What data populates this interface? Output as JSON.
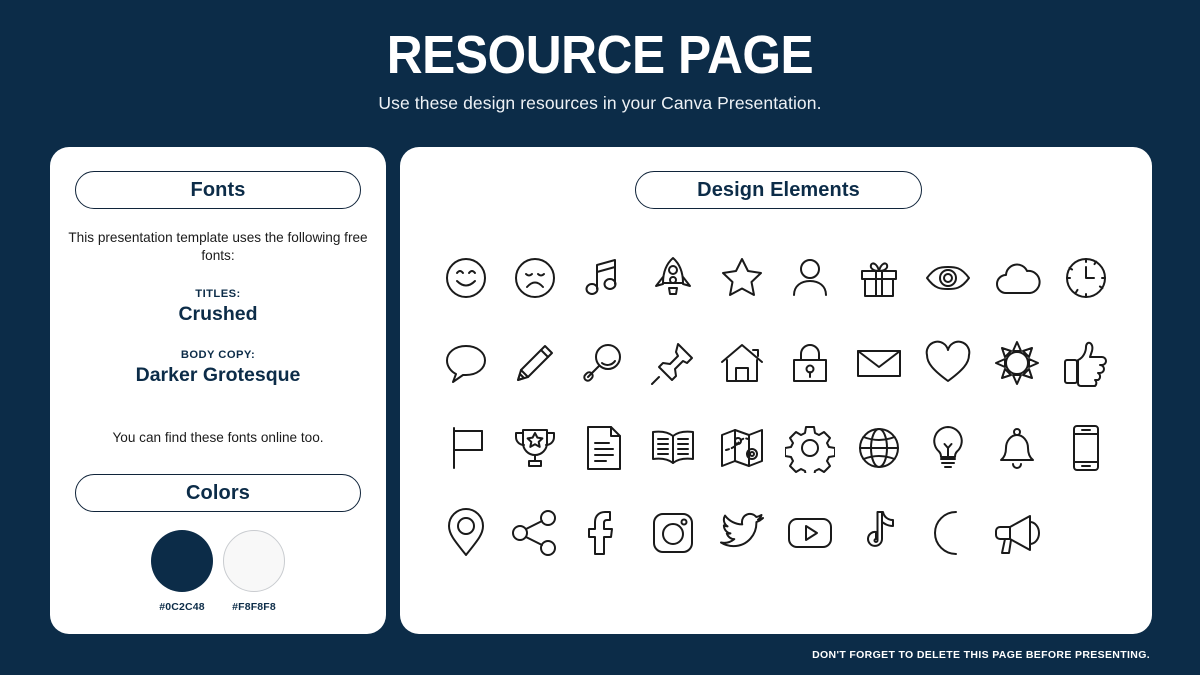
{
  "header": {
    "title": "RESOURCE PAGE",
    "subtitle": "Use these design resources in your Canva Presentation."
  },
  "fonts_card": {
    "heading": "Fonts",
    "intro": "This presentation template uses the following free fonts:",
    "titles_kicker": "TITLES:",
    "titles_font": "Crushed",
    "body_kicker": "BODY COPY:",
    "body_font": "Darker Grotesque",
    "note": "You can find these fonts online too."
  },
  "colors_card": {
    "heading": "Colors",
    "swatches": [
      {
        "hex": "#0C2C48",
        "label": "#0C2C48",
        "outlined": false
      },
      {
        "hex": "#F8F8F8",
        "label": "#F8F8F8",
        "outlined": true
      }
    ]
  },
  "elements_card": {
    "heading": "Design Elements",
    "icons": [
      {
        "name": "smiley-face-icon",
        "label": "Smiley face"
      },
      {
        "name": "sad-face-icon",
        "label": "Sad face"
      },
      {
        "name": "music-note-icon",
        "label": "Music note"
      },
      {
        "name": "rocket-icon",
        "label": "Rocket"
      },
      {
        "name": "star-icon",
        "label": "Star"
      },
      {
        "name": "person-icon",
        "label": "Person"
      },
      {
        "name": "gift-icon",
        "label": "Gift"
      },
      {
        "name": "eye-icon",
        "label": "Eye"
      },
      {
        "name": "cloud-icon",
        "label": "Cloud"
      },
      {
        "name": "clock-icon",
        "label": "Clock"
      },
      {
        "name": "speech-bubble-icon",
        "label": "Speech bubble"
      },
      {
        "name": "pencil-icon",
        "label": "Pencil"
      },
      {
        "name": "magnifying-glass-icon",
        "label": "Magnifying glass"
      },
      {
        "name": "pushpin-icon",
        "label": "Pushpin"
      },
      {
        "name": "house-icon",
        "label": "House"
      },
      {
        "name": "lock-icon",
        "label": "Lock"
      },
      {
        "name": "envelope-icon",
        "label": "Envelope"
      },
      {
        "name": "heart-icon",
        "label": "Heart"
      },
      {
        "name": "sun-icon",
        "label": "Sun"
      },
      {
        "name": "thumbs-up-icon",
        "label": "Thumbs up"
      },
      {
        "name": "flag-icon",
        "label": "Flag"
      },
      {
        "name": "trophy-icon",
        "label": "Trophy"
      },
      {
        "name": "document-icon",
        "label": "Document"
      },
      {
        "name": "open-book-icon",
        "label": "Open book"
      },
      {
        "name": "map-icon",
        "label": "Map"
      },
      {
        "name": "gear-icon",
        "label": "Gear"
      },
      {
        "name": "globe-icon",
        "label": "Globe"
      },
      {
        "name": "lightbulb-icon",
        "label": "Lightbulb"
      },
      {
        "name": "bell-icon",
        "label": "Bell"
      },
      {
        "name": "smartphone-icon",
        "label": "Smartphone"
      },
      {
        "name": "location-pin-icon",
        "label": "Location pin"
      },
      {
        "name": "share-icon",
        "label": "Share"
      },
      {
        "name": "facebook-icon",
        "label": "Facebook"
      },
      {
        "name": "instagram-icon",
        "label": "Instagram"
      },
      {
        "name": "twitter-icon",
        "label": "Twitter"
      },
      {
        "name": "youtube-icon",
        "label": "YouTube"
      },
      {
        "name": "tiktok-icon",
        "label": "TikTok"
      },
      {
        "name": "moon-icon",
        "label": "Moon"
      },
      {
        "name": "megaphone-icon",
        "label": "Megaphone"
      }
    ]
  },
  "footer": {
    "note": "DON'T FORGET TO DELETE THIS PAGE BEFORE PRESENTING."
  },
  "theme": {
    "background": "#0C2C48",
    "card_background": "#FFFFFF",
    "ink": "#0C2C48"
  }
}
